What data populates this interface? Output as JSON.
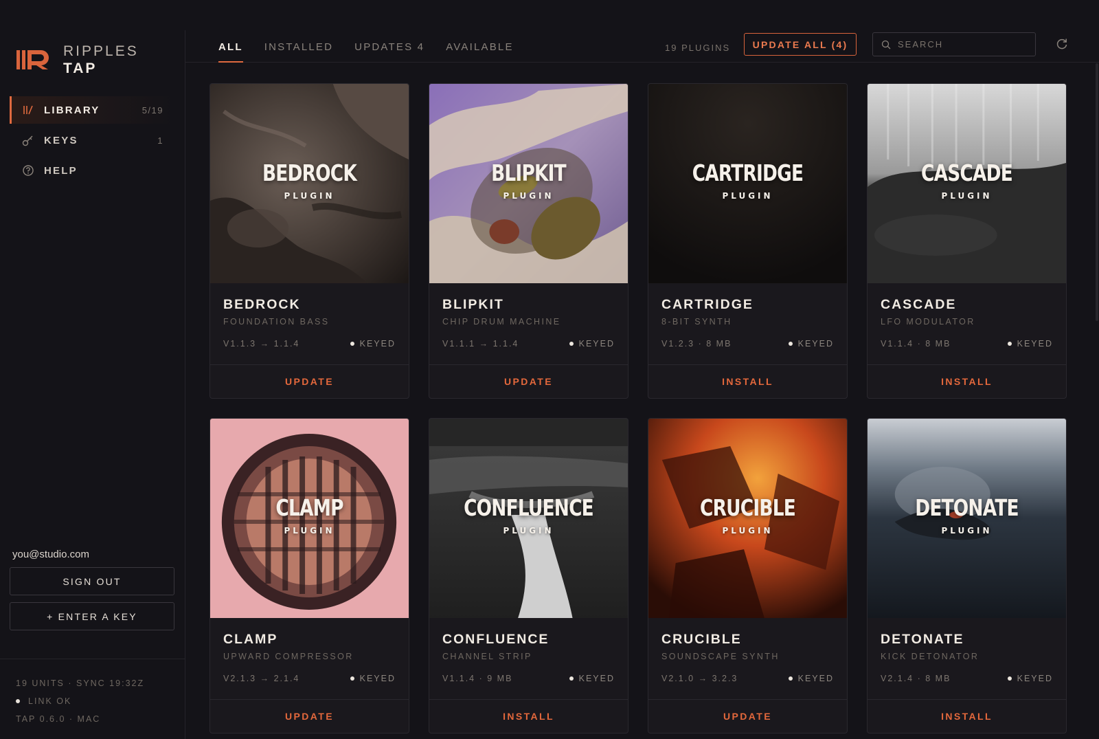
{
  "brand": {
    "line1": "RIPPLES",
    "line2": "TAP",
    "logo_icon": "ripples-logo-icon",
    "accent": "#e06a3f"
  },
  "sidebar": {
    "items": [
      {
        "label": "LIBRARY",
        "count": "5/19",
        "icon": "library-icon",
        "active": true
      },
      {
        "label": "KEYS",
        "count": "1",
        "icon": "key-icon",
        "active": false
      },
      {
        "label": "HELP",
        "count": "",
        "icon": "help-icon",
        "active": false
      }
    ],
    "email": "you@studio.com",
    "sign_out": "SIGN OUT",
    "enter_key": "+ ENTER A KEY",
    "footer": {
      "units": "19 UNITS · SYNC 19:32Z",
      "link": "LINK OK",
      "version": "TAP 0.6.0 · MAC"
    }
  },
  "topbar": {
    "tabs": [
      {
        "label": "ALL",
        "active": true
      },
      {
        "label": "INSTALLED",
        "active": false
      },
      {
        "label": "UPDATES 4",
        "active": false
      },
      {
        "label": "AVAILABLE",
        "active": false
      }
    ],
    "plugin_count": "19 PLUGINS",
    "update_all": "UPDATE ALL (4)",
    "search_placeholder": "SEARCH",
    "refresh_icon": "refresh-icon"
  },
  "cards": [
    {
      "title": "BEDROCK",
      "art_title": "BEDROCK",
      "art_sub": "PLUGIN",
      "subtitle": "FOUNDATION BASS",
      "version": "V1.1.3 → 1.1.4",
      "key": "KEYED",
      "action": "UPDATE",
      "art": "rock"
    },
    {
      "title": "BLIPKIT",
      "art_title": "BLIPKIT",
      "art_sub": "PLUGIN",
      "subtitle": "CHIP DRUM MACHINE",
      "version": "V1.1.1 → 1.1.4",
      "key": "KEYED",
      "action": "UPDATE",
      "art": "sky"
    },
    {
      "title": "CARTRIDGE",
      "art_title": "CARTRIDGE",
      "art_sub": "PLUGIN",
      "subtitle": "8-BIT SYNTH",
      "version": "V1.2.3 · 8 MB",
      "key": "KEYED",
      "action": "INSTALL",
      "art": "dark"
    },
    {
      "title": "CASCADE",
      "art_title": "CASCADE",
      "art_sub": "PLUGIN",
      "subtitle": "LFO MODULATOR",
      "version": "V1.1.4 · 8 MB",
      "key": "KEYED",
      "action": "INSTALL",
      "art": "falls"
    },
    {
      "title": "CLAMP",
      "art_title": "CLAMP",
      "art_sub": "PLUGIN",
      "subtitle": "UPWARD COMPRESSOR",
      "version": "V2.1.3 → 2.1.4",
      "key": "KEYED",
      "action": "UPDATE",
      "art": "sphere"
    },
    {
      "title": "CONFLUENCE",
      "art_title": "CONFLUENCE",
      "art_sub": "PLUGIN",
      "subtitle": "CHANNEL STRIP",
      "version": "V1.1.4 · 9 MB",
      "key": "KEYED",
      "action": "INSTALL",
      "art": "river"
    },
    {
      "title": "CRUCIBLE",
      "art_title": "CRUCIBLE",
      "art_sub": "PLUGIN",
      "subtitle": "SOUNDSCAPE SYNTH",
      "version": "V2.1.0 → 3.2.3",
      "key": "KEYED",
      "action": "UPDATE",
      "art": "fire"
    },
    {
      "title": "DETONATE",
      "art_title": "DETONATE",
      "art_sub": "PLUGIN",
      "subtitle": "KICK DETONATOR",
      "version": "V2.1.4 · 8 MB",
      "key": "KEYED",
      "action": "INSTALL",
      "art": "volcano"
    }
  ]
}
